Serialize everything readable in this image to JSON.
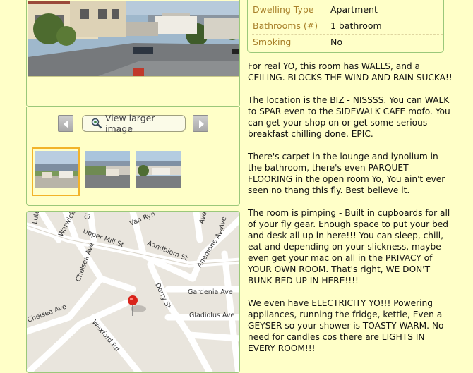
{
  "gallery": {
    "view_larger_label": "View larger image"
  },
  "details": [
    {
      "key": "Dwelling Type",
      "value": "Apartment"
    },
    {
      "key": "Bathrooms (#)",
      "value": "1 bathroom"
    },
    {
      "key": "Smoking",
      "value": "No"
    }
  ],
  "description": [
    "For real YO, this room has WALLS, and a CEILING. BLOCKS THE WIND AND RAIN SUCKA!!",
    "The location is the BIZ - NISSSS. You can WALK to SPAR even to the SIDEWALK CAFE mofo. You can get your shop on or get some serious breakfast chilling done. EPIC.",
    "There's carpet in the lounge and lynolium in the bathroom, there's even PARQUET FLOORING in the open room Yo, You ain't ever seen no thang this fly. Best believe it.",
    "The room is pimping - Built in cupboards for all of your fly gear. Enough space to put your bed and desk all up in here!!! You can sleep, chill, eat and depending on your slickness, maybe even get your mac on all in the PRIVACY of YOUR OWN ROOM. That's right, WE DON'T BUNK BED UP IN HERE!!!!",
    "We even have ELECTRICITY YO!!! Powering appliances, running the fridge, kettle, Even a GEYSER so your shower is TOASTY WARM. No need for candles cos there are LIGHTS IN EVERY ROOM!!!"
  ],
  "map": {
    "streets": [
      "Luton",
      "Warwick",
      "Upper Mill St",
      "Van Ryn",
      "Ave",
      "Ave",
      "Chelsea Ave",
      "Aandblom St",
      "Anemone Ave",
      "Derry St",
      "Gardenia Ave",
      "Chelsea Ave",
      "Gladiolus Ave",
      "Wexford Rd",
      "Cl"
    ]
  },
  "icons": [
    "chevron-left-icon",
    "chevron-right-icon",
    "magnifier-icon",
    "map-pin-icon"
  ]
}
